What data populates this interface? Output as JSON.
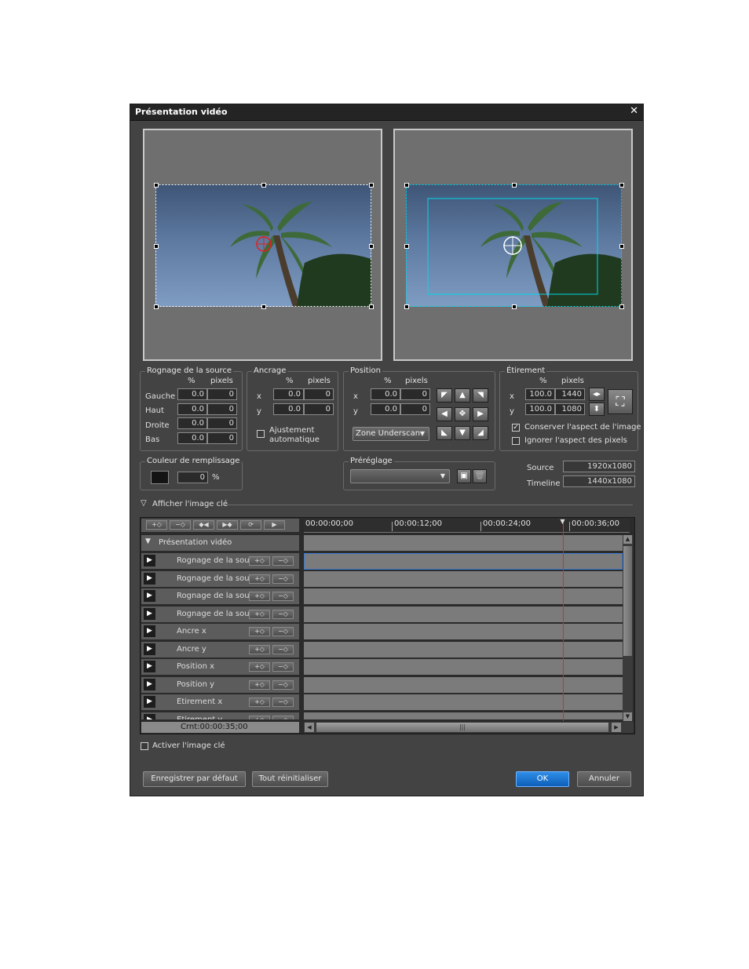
{
  "window": {
    "title": "Présentation vidéo",
    "close_glyph": "✕"
  },
  "crop": {
    "legend": "Rognage de la source",
    "col_pct": "%",
    "col_px": "pixels",
    "rows": [
      {
        "label": "Gauche",
        "pct": "0.0",
        "px": "0"
      },
      {
        "label": "Haut",
        "pct": "0.0",
        "px": "0"
      },
      {
        "label": "Droite",
        "pct": "0.0",
        "px": "0"
      },
      {
        "label": "Bas",
        "pct": "0.0",
        "px": "0"
      }
    ]
  },
  "anchor": {
    "legend": "Ancrage",
    "col_pct": "%",
    "col_px": "pixels",
    "x_label": "x",
    "x_pct": "0.0",
    "x_px": "0",
    "y_label": "y",
    "y_pct": "0.0",
    "y_px": "0",
    "auto_adjust": "Ajustement automatique",
    "auto_adjust_checked": false
  },
  "position": {
    "legend": "Position",
    "col_pct": "%",
    "col_px": "pixels",
    "x_label": "x",
    "x_pct": "0.0",
    "x_px": "0",
    "y_label": "y",
    "y_pct": "0.0",
    "y_px": "0",
    "zone": "Zone Underscan"
  },
  "stretch": {
    "legend": "Étirement",
    "col_pct": "%",
    "col_px": "pixels",
    "x_label": "x",
    "x_pct": "100.0",
    "x_px": "1440",
    "y_label": "y",
    "y_pct": "100.0",
    "y_px": "1080",
    "keep_aspect": "Conserver l'aspect de l'image",
    "keep_aspect_checked": true,
    "ignore_pixel_aspect": "Ignorer l'aspect des pixels",
    "ignore_pixel_aspect_checked": false
  },
  "fill": {
    "legend": "Couleur de remplissage",
    "color": "#141414",
    "value": "0",
    "unit": "%"
  },
  "preset": {
    "legend": "Préréglage",
    "value": ""
  },
  "info": {
    "source_label": "Source",
    "source_value": "1920x1080",
    "timeline_label": "Timeline",
    "timeline_value": "1440x1080"
  },
  "keyframe_section": {
    "label": "Afficher l'image clé"
  },
  "timeline": {
    "ticks": [
      "00:00:00;00",
      "00:00:12;00",
      "00:00:24;00",
      "00:00:36;00"
    ],
    "group": "Présentation vidéo",
    "cursor_time": "Crnt:00:00:35;00",
    "playhead_fraction": 0.8,
    "tracks": [
      "Rognage de la source",
      "Rognage de la source",
      "Rognage de la source",
      "Rognage de la source",
      "Ancre x",
      "Ancre y",
      "Position x",
      "Position y",
      "Étirement x",
      "Étirement y"
    ]
  },
  "enable_keyframe": {
    "label": "Activer l'image clé",
    "checked": false
  },
  "buttons": {
    "save_default": "Enregistrer par défaut",
    "reset_all": "Tout réinitialiser",
    "ok": "OK",
    "cancel": "Annuler"
  }
}
